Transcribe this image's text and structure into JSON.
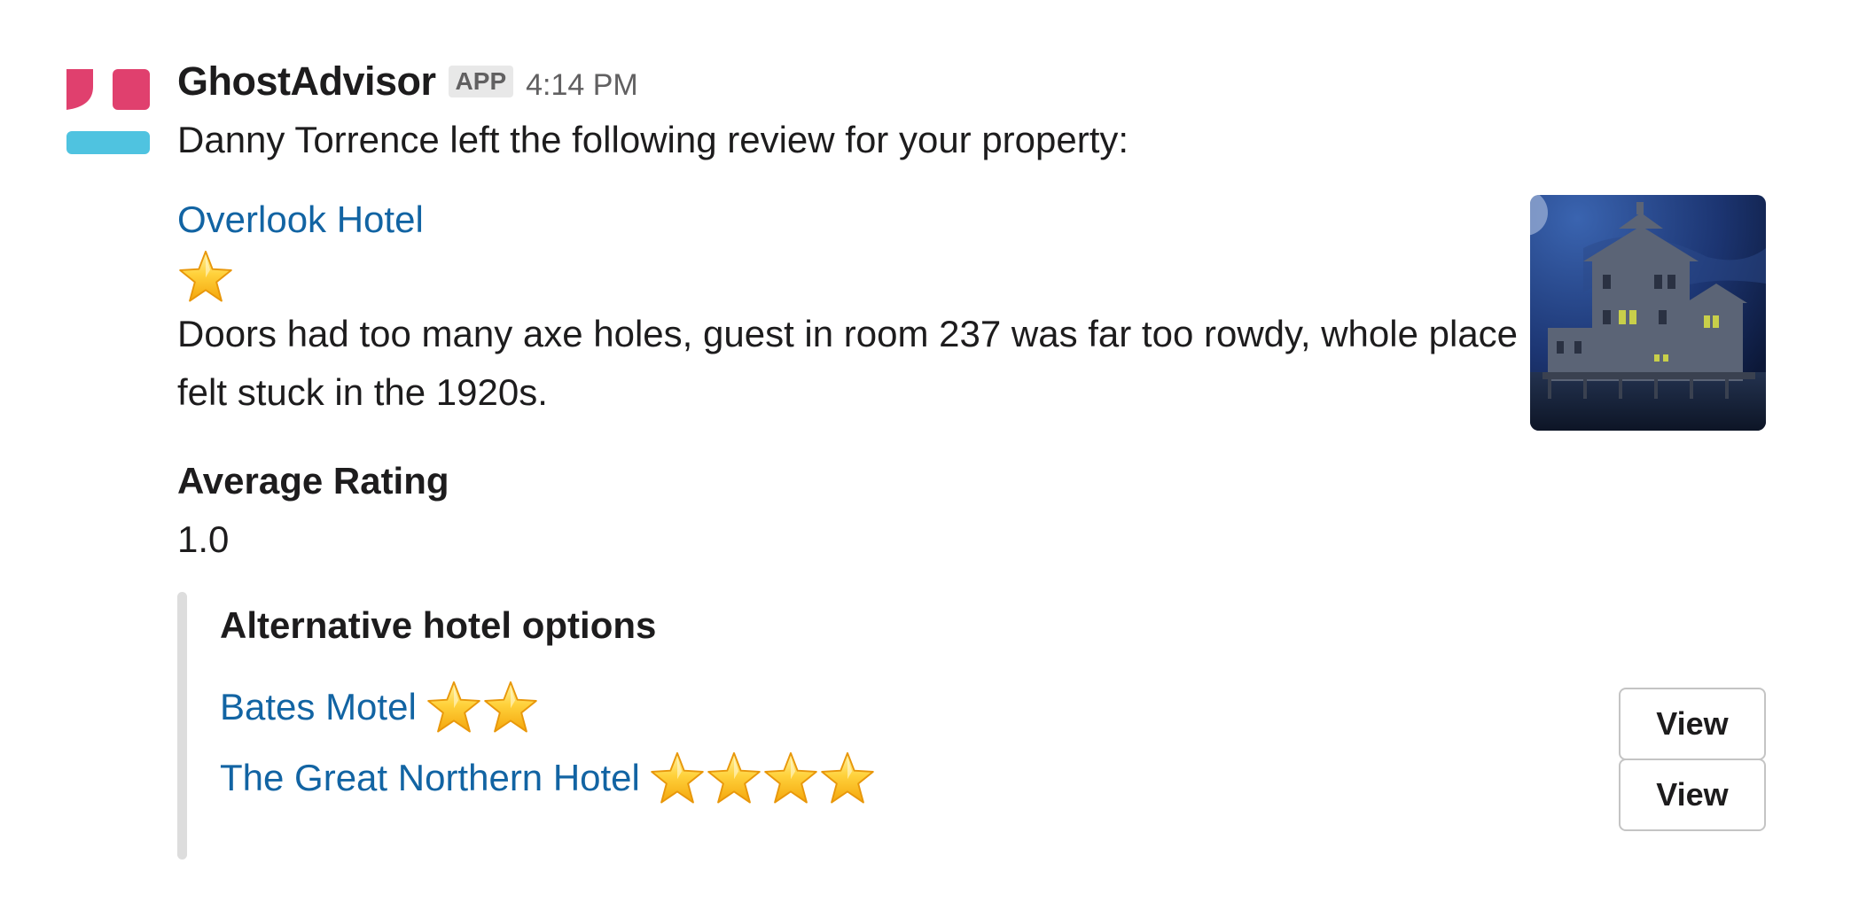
{
  "message": {
    "sender": "GhostAdvisor",
    "badge": "APP",
    "timestamp": "4:14 PM",
    "intro": "Danny Torrence left the following review for your property:"
  },
  "review": {
    "hotel_name": "Overlook Hotel",
    "rating_stars": 1,
    "text": "Doors had too many axe holes, guest in room 237 was far too rowdy, whole place felt stuck in the 1920s.",
    "thumbnail_icon": "haunted-hotel-image"
  },
  "average_rating": {
    "title": "Average Rating",
    "value": "1.0"
  },
  "alternatives": {
    "title": "Alternative hotel options",
    "options": [
      {
        "name": "Bates Motel",
        "stars": 2,
        "button_label": "View"
      },
      {
        "name": "The Great Northern Hotel",
        "stars": 4,
        "button_label": "View"
      }
    ]
  },
  "colors": {
    "link": "#1264a3",
    "avatar_pink": "#e0406e",
    "avatar_blue": "#4fc3e0",
    "attachment_bar": "#dddddd"
  }
}
